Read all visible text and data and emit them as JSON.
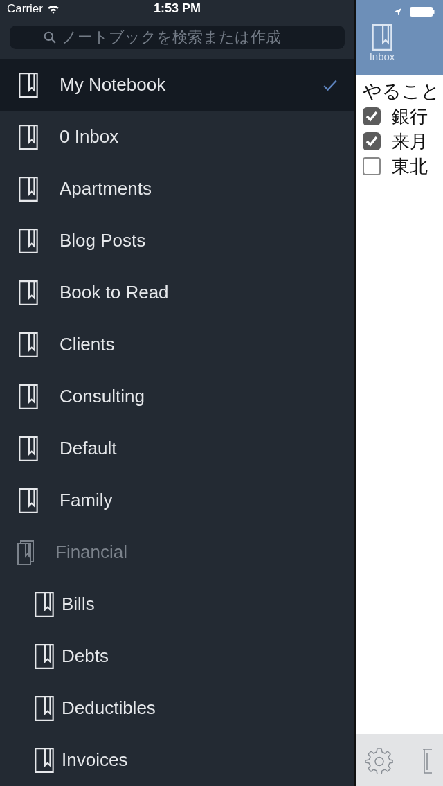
{
  "status_bar": {
    "carrier": "Carrier",
    "time": "1:53 PM"
  },
  "search": {
    "placeholder": "ノートブックを検索または作成"
  },
  "notebooks": [
    {
      "name": "My Notebook",
      "kind": "notebook",
      "selected": true
    },
    {
      "name": "0 Inbox",
      "kind": "notebook",
      "selected": false
    },
    {
      "name": "Apartments",
      "kind": "notebook",
      "selected": false
    },
    {
      "name": "Blog Posts",
      "kind": "notebook",
      "selected": false
    },
    {
      "name": "Book to Read",
      "kind": "notebook",
      "selected": false
    },
    {
      "name": "Clients",
      "kind": "notebook",
      "selected": false
    },
    {
      "name": "Consulting",
      "kind": "notebook",
      "selected": false
    },
    {
      "name": "Default",
      "kind": "notebook",
      "selected": false
    },
    {
      "name": "Family",
      "kind": "notebook",
      "selected": false
    },
    {
      "name": "Financial",
      "kind": "stack",
      "selected": false,
      "children": [
        {
          "name": "Bills",
          "kind": "notebook",
          "selected": false
        },
        {
          "name": "Debts",
          "kind": "notebook",
          "selected": false
        },
        {
          "name": "Deductibles",
          "kind": "notebook",
          "selected": false
        },
        {
          "name": "Invoices",
          "kind": "notebook",
          "selected": false
        }
      ]
    }
  ],
  "note_pane": {
    "notebook_label": "Inbox",
    "title": "やること",
    "todos": [
      {
        "text": "銀行",
        "checked": true
      },
      {
        "text": "来月",
        "checked": true
      },
      {
        "text": "東北",
        "checked": false
      }
    ]
  }
}
